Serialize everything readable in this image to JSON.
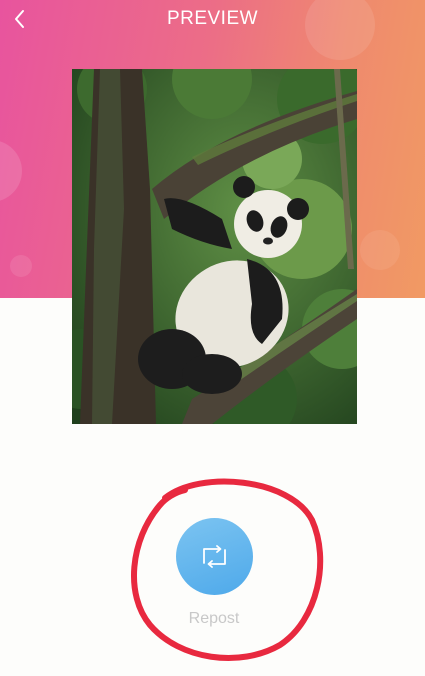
{
  "header": {
    "title": "PREVIEW",
    "back_icon": "chevron-left-icon"
  },
  "preview": {
    "image": "panda-in-tree"
  },
  "actions": {
    "repost_label": "Repost",
    "repost_icon": "repost-icon"
  },
  "colors": {
    "header_gradient_start": "#e8549e",
    "header_gradient_end": "#f19a63",
    "repost_button": "#5eb4ee",
    "annotation_circle": "#e8293f",
    "label_gray": "#c8c8c8"
  }
}
